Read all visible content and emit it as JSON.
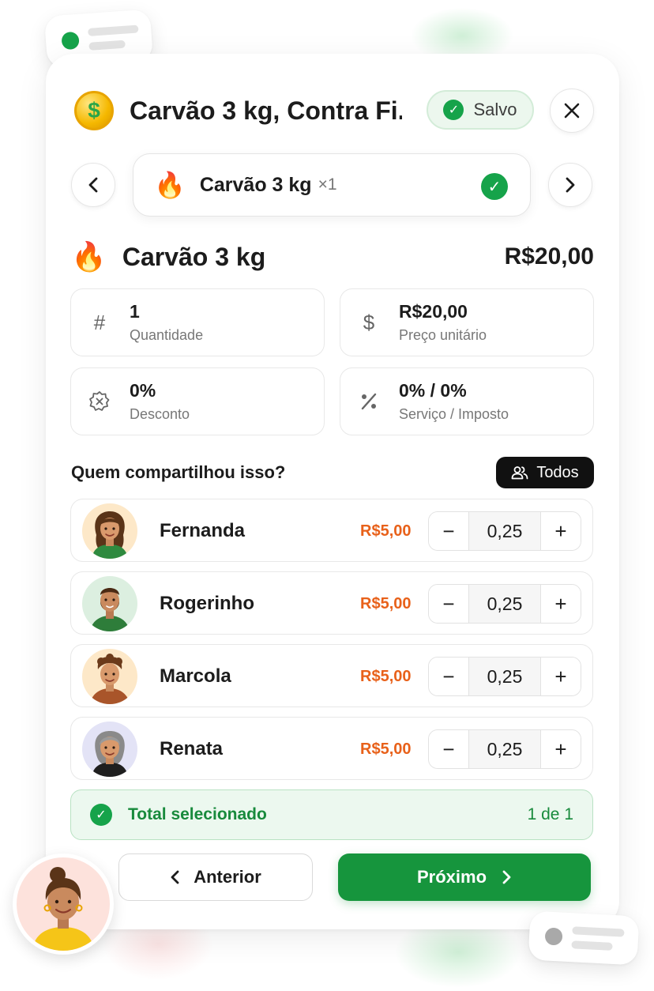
{
  "header": {
    "title": "Carvão 3 kg, Contra Fi...",
    "saved_label": "Salvo"
  },
  "item_nav": {
    "item_name": "Carvão 3 kg",
    "item_qty": "×1"
  },
  "item": {
    "name": "Carvão 3 kg",
    "price": "R$20,00"
  },
  "stats": {
    "quantity": {
      "value": "1",
      "label": "Quantidade"
    },
    "unit_price": {
      "value": "R$20,00",
      "label": "Preço unitário"
    },
    "discount": {
      "value": "0%",
      "label": "Desconto"
    },
    "service_tax": {
      "value": "0% / 0%",
      "label": "Serviço / Imposto"
    }
  },
  "share": {
    "title": "Quem compartilhou isso?",
    "all_label": "Todos",
    "people": [
      {
        "name": "Fernanda",
        "amount": "R$5,00",
        "share": "0,25"
      },
      {
        "name": "Rogerinho",
        "amount": "R$5,00",
        "share": "0,25"
      },
      {
        "name": "Marcola",
        "amount": "R$5,00",
        "share": "0,25"
      },
      {
        "name": "Renata",
        "amount": "R$5,00",
        "share": "0,25"
      }
    ]
  },
  "total": {
    "label": "Total selecionado",
    "count": "1 de 1"
  },
  "footer": {
    "prev_label": "Anterior",
    "next_label": "Próximo"
  },
  "colors": {
    "brand_green": "#16953d",
    "amount_orange": "#e8611a",
    "success_bg": "#ecf8ef"
  }
}
